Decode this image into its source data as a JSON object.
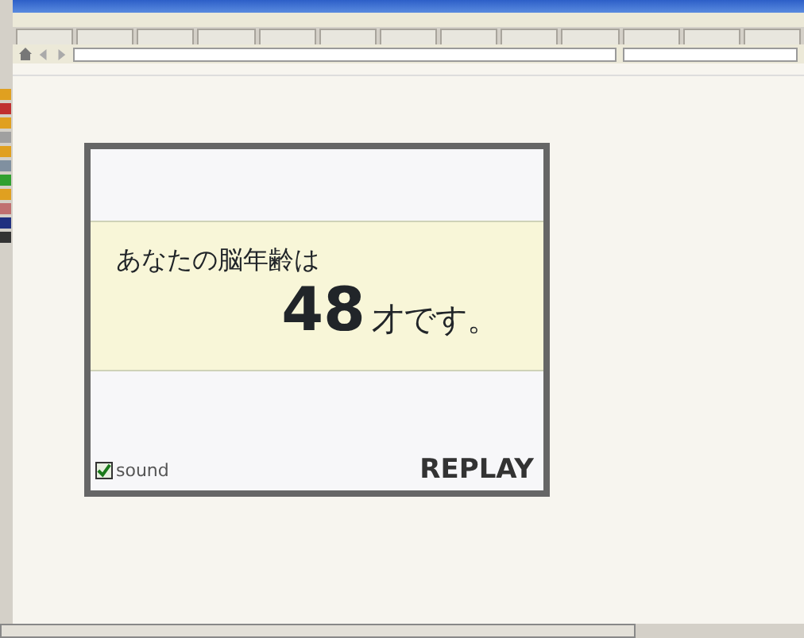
{
  "result": {
    "prompt": "あなたの脳年齢は",
    "age": "48",
    "suffix": "才です。"
  },
  "sound": {
    "label": "sound",
    "checked": true
  },
  "replay": {
    "label": "REPLAY"
  }
}
